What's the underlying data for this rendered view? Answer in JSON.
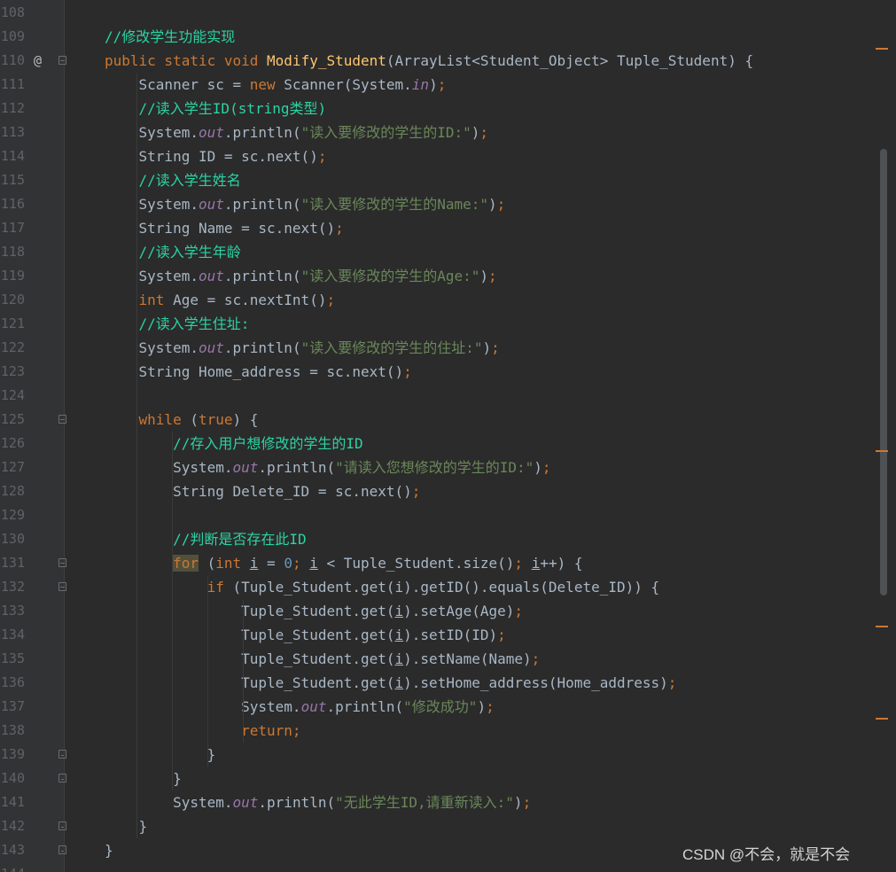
{
  "editor": {
    "lines": [
      {
        "n": "108",
        "segs": []
      },
      {
        "n": "109",
        "segs": [
          {
            "t": "//修改学生功能实现",
            "c": "cm"
          }
        ]
      },
      {
        "n": "110",
        "segs": [
          {
            "t": "public static void ",
            "c": "kw"
          },
          {
            "t": "Modify_Student",
            "c": "fn"
          },
          {
            "t": "(ArrayList<Student_Object> Tuple_Student) {",
            "c": ""
          }
        ]
      },
      {
        "n": "111",
        "segs": [
          {
            "t": "    Scanner sc = ",
            "c": ""
          },
          {
            "t": "new ",
            "c": "kw"
          },
          {
            "t": "Scanner(System.",
            "c": ""
          },
          {
            "t": "in",
            "c": "fld"
          },
          {
            "t": ")",
            "c": ""
          },
          {
            "t": ";",
            "c": "kw"
          }
        ]
      },
      {
        "n": "112",
        "segs": [
          {
            "t": "    //读入学生ID(string类型)",
            "c": "cm"
          }
        ]
      },
      {
        "n": "113",
        "segs": [
          {
            "t": "    System.",
            "c": ""
          },
          {
            "t": "out",
            "c": "fld"
          },
          {
            "t": ".println(",
            "c": ""
          },
          {
            "t": "\"读入要修改的学生的ID:\"",
            "c": "str"
          },
          {
            "t": ")",
            "c": ""
          },
          {
            "t": ";",
            "c": "kw"
          }
        ]
      },
      {
        "n": "114",
        "segs": [
          {
            "t": "    String ID = sc.next()",
            "c": ""
          },
          {
            "t": ";",
            "c": "kw"
          }
        ]
      },
      {
        "n": "115",
        "segs": [
          {
            "t": "    //读入学生姓名",
            "c": "cm"
          }
        ]
      },
      {
        "n": "116",
        "segs": [
          {
            "t": "    System.",
            "c": ""
          },
          {
            "t": "out",
            "c": "fld"
          },
          {
            "t": ".println(",
            "c": ""
          },
          {
            "t": "\"读入要修改的学生的Name:\"",
            "c": "str"
          },
          {
            "t": ")",
            "c": ""
          },
          {
            "t": ";",
            "c": "kw"
          }
        ]
      },
      {
        "n": "117",
        "segs": [
          {
            "t": "    String Name = sc.next()",
            "c": ""
          },
          {
            "t": ";",
            "c": "kw"
          }
        ]
      },
      {
        "n": "118",
        "segs": [
          {
            "t": "    //读入学生年龄",
            "c": "cm"
          }
        ]
      },
      {
        "n": "119",
        "segs": [
          {
            "t": "    System.",
            "c": ""
          },
          {
            "t": "out",
            "c": "fld"
          },
          {
            "t": ".println(",
            "c": ""
          },
          {
            "t": "\"读入要修改的学生的Age:\"",
            "c": "str"
          },
          {
            "t": ")",
            "c": ""
          },
          {
            "t": ";",
            "c": "kw"
          }
        ]
      },
      {
        "n": "120",
        "segs": [
          {
            "t": "    ",
            "c": ""
          },
          {
            "t": "int ",
            "c": "kw"
          },
          {
            "t": "Age = sc.nextInt()",
            "c": ""
          },
          {
            "t": ";",
            "c": "kw"
          }
        ]
      },
      {
        "n": "121",
        "segs": [
          {
            "t": "    //读入学生住址:",
            "c": "cm"
          }
        ]
      },
      {
        "n": "122",
        "segs": [
          {
            "t": "    System.",
            "c": ""
          },
          {
            "t": "out",
            "c": "fld"
          },
          {
            "t": ".println(",
            "c": ""
          },
          {
            "t": "\"读入要修改的学生的住址:\"",
            "c": "str"
          },
          {
            "t": ")",
            "c": ""
          },
          {
            "t": ";",
            "c": "kw"
          }
        ]
      },
      {
        "n": "123",
        "segs": [
          {
            "t": "    String Home_address = sc.next()",
            "c": ""
          },
          {
            "t": ";",
            "c": "kw"
          }
        ]
      },
      {
        "n": "124",
        "segs": []
      },
      {
        "n": "125",
        "segs": [
          {
            "t": "    ",
            "c": ""
          },
          {
            "t": "while ",
            "c": "kw"
          },
          {
            "t": "(",
            "c": ""
          },
          {
            "t": "true",
            "c": "kw"
          },
          {
            "t": ") {",
            "c": ""
          }
        ]
      },
      {
        "n": "126",
        "segs": [
          {
            "t": "        //存入用户想修改的学生的ID",
            "c": "cm"
          }
        ]
      },
      {
        "n": "127",
        "segs": [
          {
            "t": "        System.",
            "c": ""
          },
          {
            "t": "out",
            "c": "fld"
          },
          {
            "t": ".println(",
            "c": ""
          },
          {
            "t": "\"请读入您想修改的学生的ID:\"",
            "c": "str"
          },
          {
            "t": ")",
            "c": ""
          },
          {
            "t": ";",
            "c": "kw"
          }
        ]
      },
      {
        "n": "128",
        "segs": [
          {
            "t": "        String Delete_ID = sc.next()",
            "c": ""
          },
          {
            "t": ";",
            "c": "kw"
          }
        ]
      },
      {
        "n": "129",
        "segs": []
      },
      {
        "n": "130",
        "segs": [
          {
            "t": "        //判断是否存在此ID",
            "c": "cm"
          }
        ]
      },
      {
        "n": "131",
        "segs": [
          {
            "t": "        ",
            "c": ""
          },
          {
            "t": "for",
            "c": "kw for-hl"
          },
          {
            "t": " (",
            "c": ""
          },
          {
            "t": "int ",
            "c": "kw"
          },
          {
            "t": "i",
            "c": "und"
          },
          {
            "t": " = ",
            "c": ""
          },
          {
            "t": "0",
            "c": "num"
          },
          {
            "t": "; ",
            "c": "kw"
          },
          {
            "t": "i",
            "c": "und"
          },
          {
            "t": " < Tuple_Student.size()",
            "c": ""
          },
          {
            "t": "; ",
            "c": "kw"
          },
          {
            "t": "i",
            "c": "und"
          },
          {
            "t": "++) {",
            "c": ""
          }
        ]
      },
      {
        "n": "132",
        "segs": [
          {
            "t": "            ",
            "c": ""
          },
          {
            "t": "if ",
            "c": "kw"
          },
          {
            "t": "(Tuple_Student.get(i).getID().equals(Delete_ID)) {",
            "c": ""
          }
        ]
      },
      {
        "n": "133",
        "segs": [
          {
            "t": "                Tuple_Student.get(",
            "c": ""
          },
          {
            "t": "i",
            "c": "und"
          },
          {
            "t": ").setAge(Age)",
            "c": ""
          },
          {
            "t": ";",
            "c": "kw"
          }
        ]
      },
      {
        "n": "134",
        "segs": [
          {
            "t": "                Tuple_Student.get(",
            "c": ""
          },
          {
            "t": "i",
            "c": "und"
          },
          {
            "t": ").setID(ID)",
            "c": ""
          },
          {
            "t": ";",
            "c": "kw"
          }
        ]
      },
      {
        "n": "135",
        "segs": [
          {
            "t": "                Tuple_Student.get(",
            "c": ""
          },
          {
            "t": "i",
            "c": "und"
          },
          {
            "t": ").setName(Name)",
            "c": ""
          },
          {
            "t": ";",
            "c": "kw"
          }
        ]
      },
      {
        "n": "136",
        "segs": [
          {
            "t": "                Tuple_Student.get(",
            "c": ""
          },
          {
            "t": "i",
            "c": "und"
          },
          {
            "t": ").setHome_address(Home_address)",
            "c": ""
          },
          {
            "t": ";",
            "c": "kw"
          }
        ]
      },
      {
        "n": "137",
        "segs": [
          {
            "t": "                System.",
            "c": ""
          },
          {
            "t": "out",
            "c": "fld"
          },
          {
            "t": ".println(",
            "c": ""
          },
          {
            "t": "\"修改成功\"",
            "c": "str"
          },
          {
            "t": ")",
            "c": ""
          },
          {
            "t": ";",
            "c": "kw"
          }
        ]
      },
      {
        "n": "138",
        "segs": [
          {
            "t": "                ",
            "c": ""
          },
          {
            "t": "return;",
            "c": "kw"
          }
        ]
      },
      {
        "n": "139",
        "segs": [
          {
            "t": "            }",
            "c": ""
          }
        ]
      },
      {
        "n": "140",
        "segs": [
          {
            "t": "        }",
            "c": ""
          }
        ]
      },
      {
        "n": "141",
        "segs": [
          {
            "t": "        System.",
            "c": ""
          },
          {
            "t": "out",
            "c": "fld"
          },
          {
            "t": ".println(",
            "c": ""
          },
          {
            "t": "\"无此学生ID,请重新读入:\"",
            "c": "str"
          },
          {
            "t": ")",
            "c": ""
          },
          {
            "t": ";",
            "c": "kw"
          }
        ]
      },
      {
        "n": "142",
        "segs": [
          {
            "t": "    }",
            "c": ""
          }
        ]
      },
      {
        "n": "143",
        "segs": [
          {
            "t": "}",
            "c": ""
          }
        ]
      },
      {
        "n": "144",
        "segs": []
      }
    ],
    "override_annotation": "@",
    "colors": {
      "background": "#2b2b2b",
      "keyword": "#cc7832",
      "function": "#ffc66d",
      "string": "#6a8759",
      "comment": "#2bd3a3",
      "field": "#9876aa",
      "number": "#6897bb",
      "text": "#a9b7c6"
    }
  },
  "watermark": "CSDN @不会，就是不会"
}
